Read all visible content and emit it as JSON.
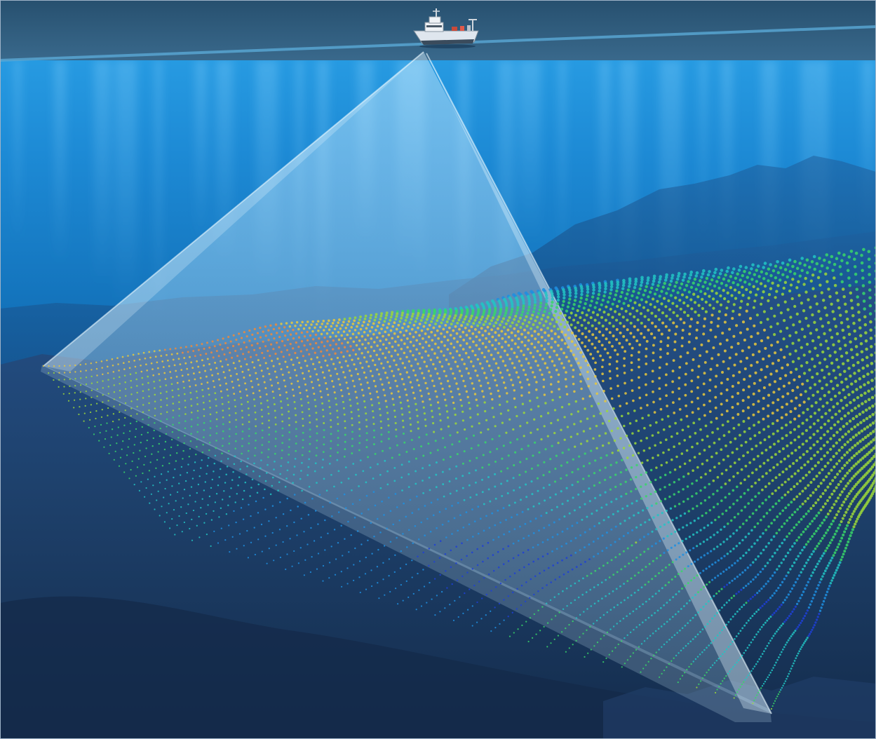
{
  "scene": {
    "kind": "multibeam-sonar-survey-illustration",
    "elements": [
      "sky",
      "sea-surface",
      "survey-vessel-icon",
      "water-column",
      "underwater-ridges",
      "sonar-swath-beam",
      "seafloor",
      "bathymetry-point-cloud"
    ]
  },
  "colors": {
    "sky": "#2b5577",
    "sky_horizon": "#3c6d90",
    "water_top": "#2aa0e6",
    "water_mid": "#1270b8",
    "water_deep": "#0c4a8c",
    "seafloor": "#1d3d66",
    "seafloor_dark": "#132d50",
    "ridge": "#1d5898",
    "beam": "#b9e6ff",
    "vessel_hull": "#dfe6ee",
    "point_ramp": [
      "#1f3fd6",
      "#1f8fe0",
      "#22c4c4",
      "#38d66a",
      "#9bd83a",
      "#e8c83c",
      "#ef8a3a"
    ]
  }
}
